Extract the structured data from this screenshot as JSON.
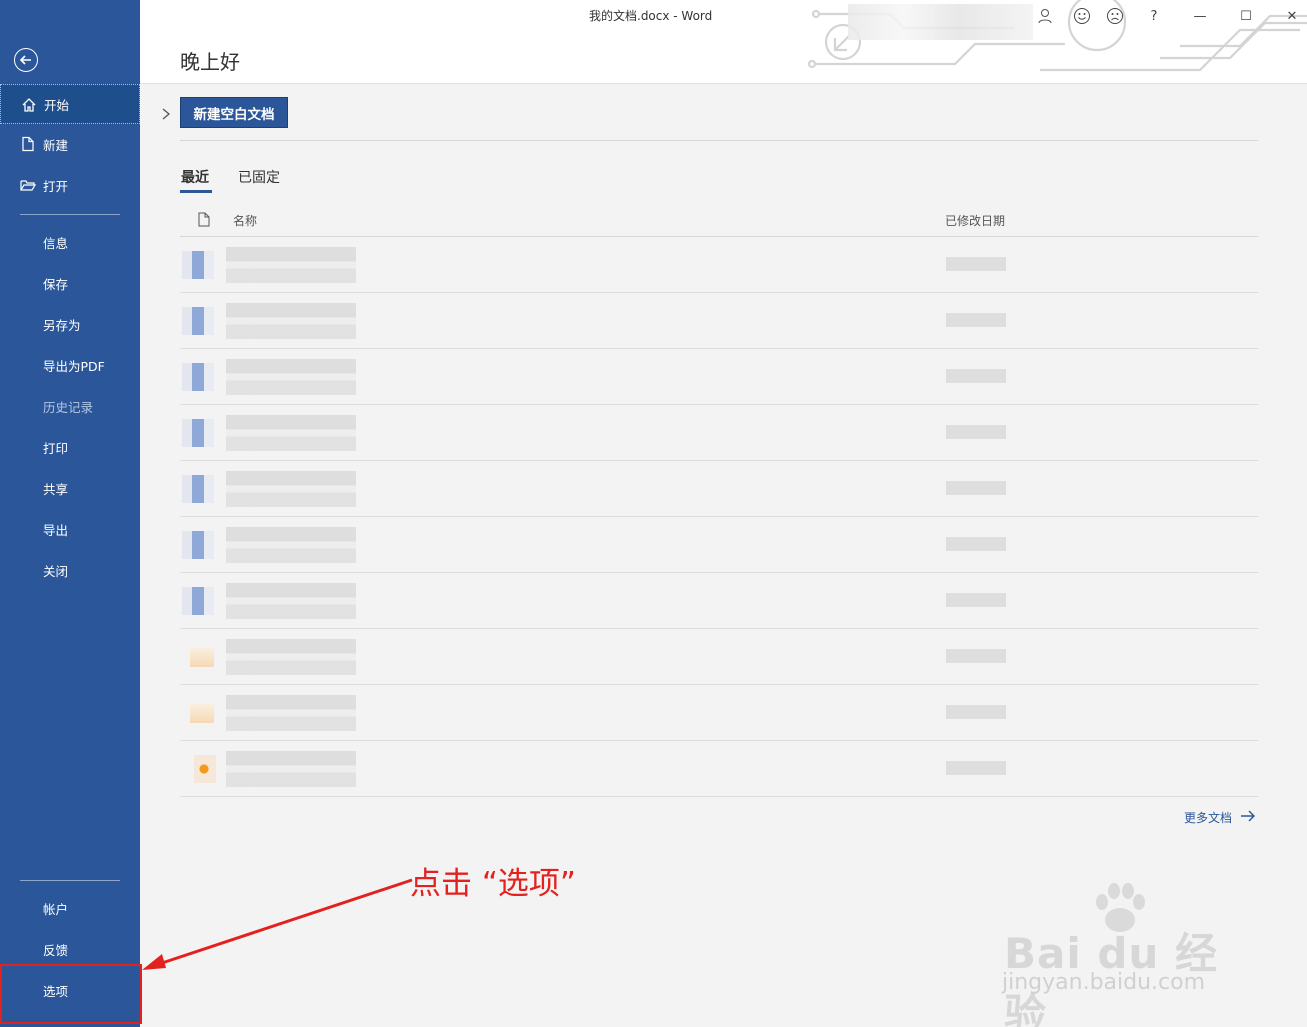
{
  "window": {
    "title": "我的文档.docx  -  Word",
    "buttons": {
      "minimize": "—",
      "maximize": "☐",
      "close": "✕",
      "help": "?"
    }
  },
  "header": {
    "greeting": "晚上好"
  },
  "sidebar": {
    "items": [
      {
        "label": "开始",
        "icon": "home-icon"
      },
      {
        "label": "新建",
        "icon": "new-document-icon"
      },
      {
        "label": "打开",
        "icon": "open-folder-icon"
      },
      {
        "label": "信息"
      },
      {
        "label": "保存"
      },
      {
        "label": "另存为"
      },
      {
        "label": "导出为PDF"
      },
      {
        "label": "历史记录"
      },
      {
        "label": "打印"
      },
      {
        "label": "共享"
      },
      {
        "label": "导出"
      },
      {
        "label": "关闭"
      },
      {
        "label": "帐户"
      },
      {
        "label": "反馈"
      },
      {
        "label": "选项"
      }
    ]
  },
  "main": {
    "new_blank_label": "新建空白文档",
    "tabs": [
      {
        "label": "最近"
      },
      {
        "label": "已固定"
      }
    ],
    "columns": {
      "name": "名称",
      "modified": "已修改日期"
    },
    "more_docs_label": "更多文档",
    "rows": [
      {
        "kind": "word"
      },
      {
        "kind": "word"
      },
      {
        "kind": "word"
      },
      {
        "kind": "word"
      },
      {
        "kind": "word"
      },
      {
        "kind": "word"
      },
      {
        "kind": "word"
      },
      {
        "kind": "folder"
      },
      {
        "kind": "folder"
      },
      {
        "kind": "orange"
      }
    ]
  },
  "annotation": {
    "text": "点击 “选项”",
    "color": "#e3221f"
  },
  "watermark": {
    "brand": "Bai  du 经验",
    "url": "jingyan.baidu.com"
  },
  "colors": {
    "accent": "#2b579a",
    "annotation": "#e3221f"
  }
}
